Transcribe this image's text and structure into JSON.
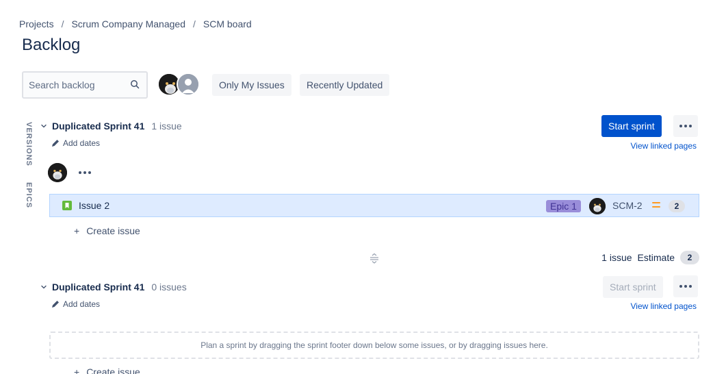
{
  "breadcrumb": [
    "Projects",
    "Scrum Company Managed",
    "SCM board"
  ],
  "page": {
    "title": "Backlog"
  },
  "search": {
    "placeholder": "Search backlog"
  },
  "filters": {
    "only_mine": "Only My Issues",
    "recent": "Recently Updated"
  },
  "side_tabs": {
    "versions": "VERSIONS",
    "epics": "EPICS"
  },
  "sprints": [
    {
      "name": "Duplicated Sprint 41",
      "count": "1 issue",
      "add_dates": "Add dates",
      "start_label": "Start sprint",
      "linked": "View linked pages",
      "issues": [
        {
          "summary": "Issue 2",
          "epic": "Epic 1",
          "key": "SCM-2",
          "points": "2",
          "priority": "medium"
        }
      ],
      "create_label": "Create issue",
      "footer": {
        "issues": "1 issue",
        "estimate_label": "Estimate",
        "estimate": "2"
      }
    },
    {
      "name": "Duplicated Sprint 41",
      "count": "0 issues",
      "add_dates": "Add dates",
      "start_label": "Start sprint",
      "linked": "View linked pages",
      "empty_message": "Plan a sprint by dragging the sprint footer down below some issues, or by dragging issues here.",
      "create_label": "Create issue"
    }
  ],
  "colors": {
    "primary": "#0052cc",
    "selected_row": "#deebff",
    "epic": "#998dd9",
    "story": "#63ba3c",
    "priority_medium": "#ff991f"
  }
}
